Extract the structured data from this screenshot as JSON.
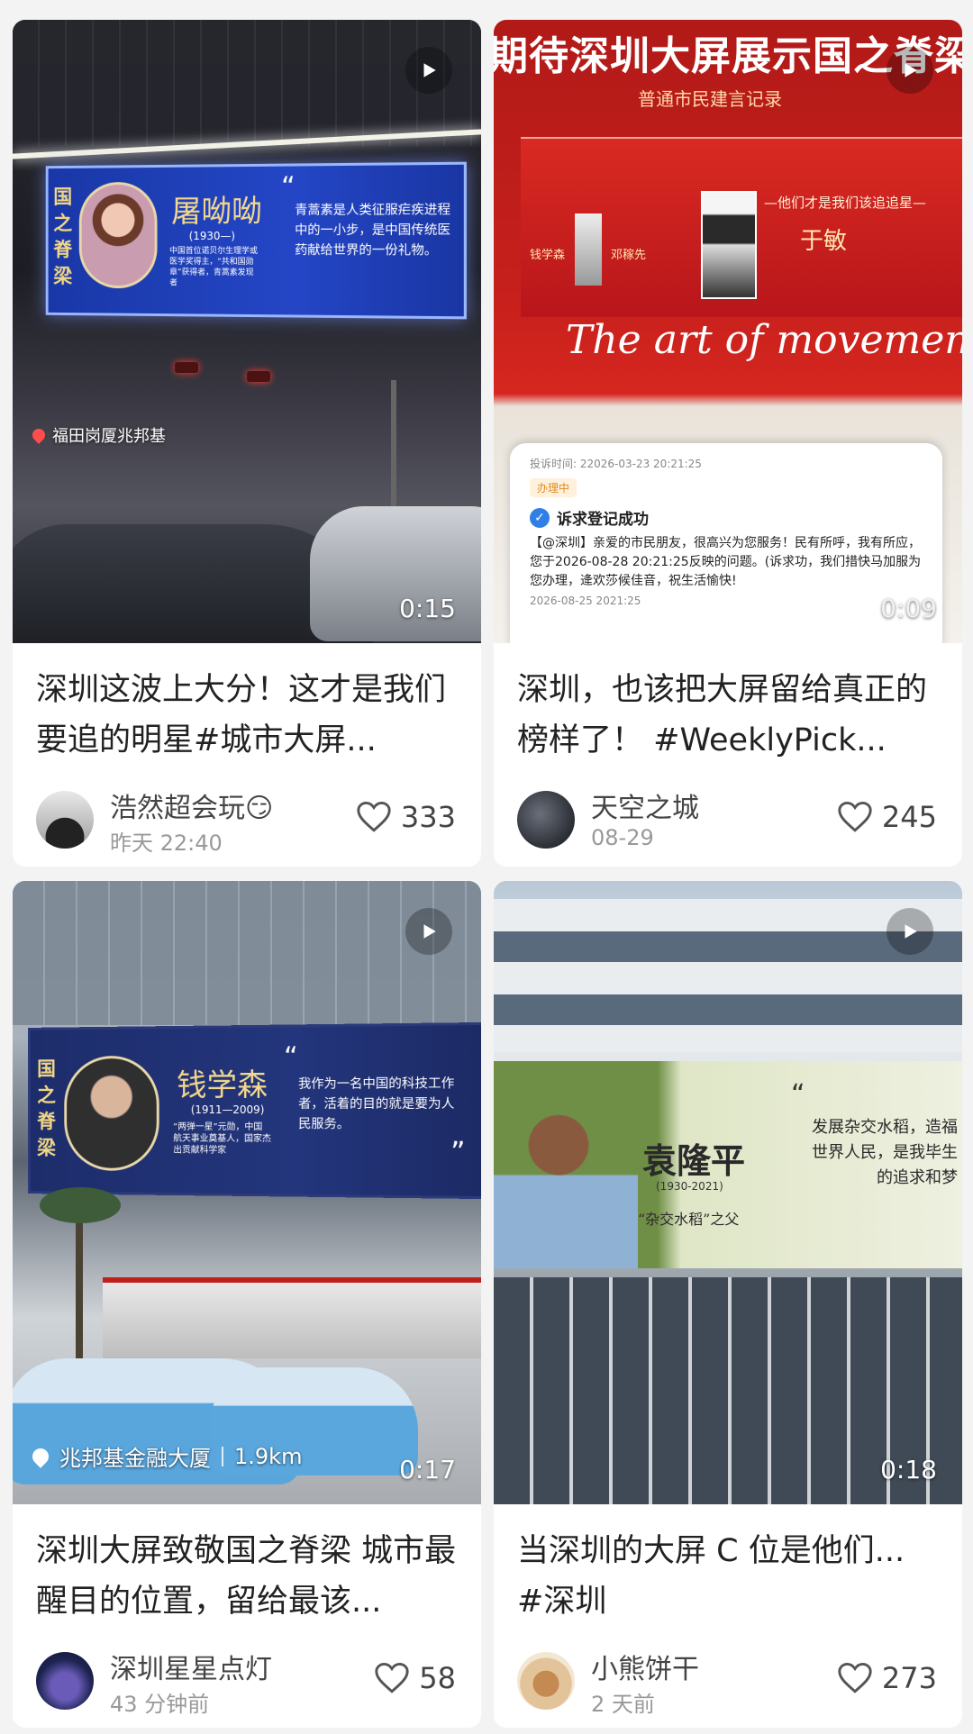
{
  "cards": [
    {
      "title": "深圳这波上大分！这才是我们要追的明星#城市大屏...",
      "author": "浩然超会玩😏",
      "time": "昨天 22:40",
      "likes": "333",
      "duration": "0:15",
      "location": "福田岗厦兆邦基",
      "cover": {
        "badge": "国之脊梁",
        "name": "屠呦呦",
        "years": "(1930—)",
        "desc": "中国首位诺贝尔生理学或医学奖得主，“共和国勋章”获得者，青蒿素发现者",
        "quote": "青蒿素是人类征服疟疾进程中的一小步，是中国传统医药献给世界的一份礼物。"
      }
    },
    {
      "title": "深圳，也该把大屏留给真正的榜样了！ #WeeklyPick...",
      "author": "天空之城",
      "time": "08-29",
      "likes": "245",
      "duration": "0:09",
      "cover": {
        "headline": "期待深圳大屏展示国之脊梁",
        "subhead": "普通市民建言记录",
        "banner": "—他们才是我们该追追星—",
        "names": [
          "钱学森",
          "邓稼先",
          "于敏"
        ],
        "overlay": "The art of movement",
        "ticket_time": "投诉时间: 22026-03-23 20:21:25",
        "ticket_status": "办理中",
        "ticket_title": "诉求登记成功",
        "ticket_body": "【@深圳】亲爱的市民朋友，很高兴为您服务！民有所呼，我有所应，您于2026-08-28 20:21:25反映的问题。(诉求功，我们措快马加服为您办理，逄欢莎候佳音，祝生活愉快!",
        "ticket_footer": "2026-08-25 2021:25"
      }
    },
    {
      "title": "深圳大屏致敬国之脊梁 城市最醒目的位置，留给最该...",
      "author": "深圳星星点灯",
      "time": "43 分钟前",
      "likes": "58",
      "duration": "0:17",
      "location": "兆邦基金融大厦",
      "distance": "1.9km",
      "cover": {
        "badge": "国之脊梁",
        "name": "钱学森",
        "years": "(1911—2009)",
        "desc": "“两弹一星”元勋，中国航天事业奠基人，国家杰出贡献科学家",
        "quote": "我作为一名中国的科技工作者，活着的目的就是要为人民服务。"
      }
    },
    {
      "title": "当深圳的大屏 C 位是他们... #深圳",
      "author": "小熊饼干",
      "time": "2 天前",
      "likes": "273",
      "duration": "0:18",
      "cover": {
        "name": "袁隆平",
        "years": "(1930-2021)",
        "desc": "“杂交水稻”之父",
        "quote": "发展杂交水稻，造福世界人民，是我毕生的追求和梦"
      }
    }
  ],
  "colors": {
    "background": "#f3f3f3",
    "card": "#ffffff",
    "billboard_blue": "#1d3aa8",
    "billboard_navy": "#1e2f6b",
    "red_wall": "#c8201c"
  }
}
